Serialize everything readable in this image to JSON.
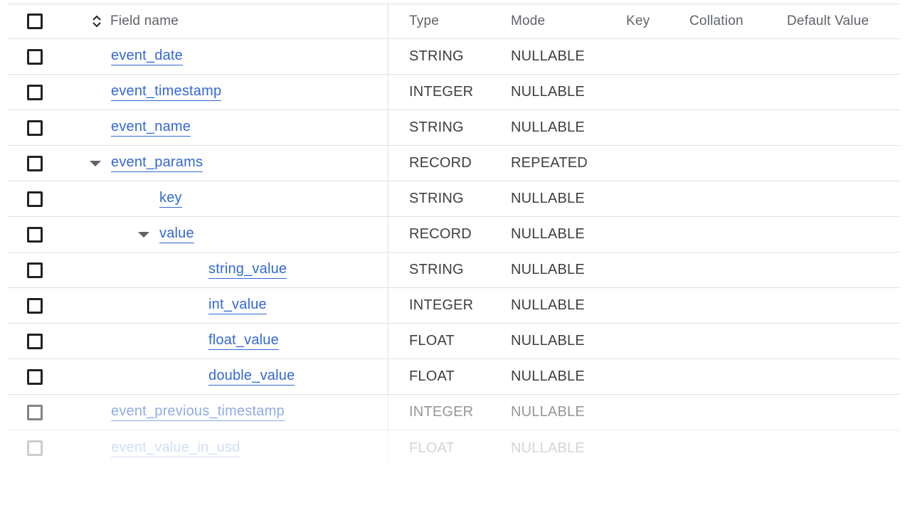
{
  "header": {
    "field_name": "Field name",
    "type": "Type",
    "mode": "Mode",
    "key": "Key",
    "collation": "Collation",
    "default_value": "Default Value"
  },
  "rows": [
    {
      "name": "event_date",
      "type": "STRING",
      "mode": "NULLABLE",
      "indent": 0,
      "expandable": false
    },
    {
      "name": "event_timestamp",
      "type": "INTEGER",
      "mode": "NULLABLE",
      "indent": 0,
      "expandable": false
    },
    {
      "name": "event_name",
      "type": "STRING",
      "mode": "NULLABLE",
      "indent": 0,
      "expandable": false
    },
    {
      "name": "event_params",
      "type": "RECORD",
      "mode": "REPEATED",
      "indent": 0,
      "expandable": true,
      "expanded": true
    },
    {
      "name": "key",
      "type": "STRING",
      "mode": "NULLABLE",
      "indent": 1,
      "expandable": false
    },
    {
      "name": "value",
      "type": "RECORD",
      "mode": "NULLABLE",
      "indent": 1,
      "expandable": true,
      "expanded": true
    },
    {
      "name": "string_value",
      "type": "STRING",
      "mode": "NULLABLE",
      "indent": 2,
      "expandable": false
    },
    {
      "name": "int_value",
      "type": "INTEGER",
      "mode": "NULLABLE",
      "indent": 2,
      "expandable": false
    },
    {
      "name": "float_value",
      "type": "FLOAT",
      "mode": "NULLABLE",
      "indent": 2,
      "expandable": false
    },
    {
      "name": "double_value",
      "type": "FLOAT",
      "mode": "NULLABLE",
      "indent": 2,
      "expandable": false
    },
    {
      "name": "event_previous_timestamp",
      "type": "INTEGER",
      "mode": "NULLABLE",
      "indent": 0,
      "expandable": false
    },
    {
      "name": "event_value_in_usd",
      "type": "FLOAT",
      "mode": "NULLABLE",
      "indent": 0,
      "expandable": false
    }
  ],
  "icons": {
    "sort": "sort-unfold-icon",
    "expand": "caret-down-icon",
    "checkbox": "checkbox-unchecked-icon"
  },
  "colors": {
    "link": "#3367d6",
    "text": "#3c4043",
    "header_text": "#5f6368",
    "divider": "#e0e0e0",
    "checkbox_border": "#202124"
  }
}
